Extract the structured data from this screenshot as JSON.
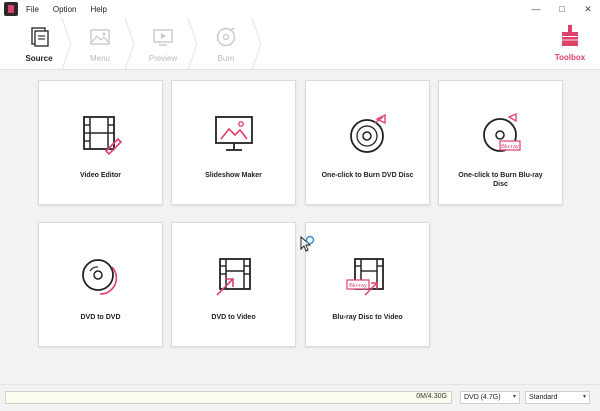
{
  "menu": [
    "File",
    "Option",
    "Help"
  ],
  "window_controls": [
    "—",
    "□",
    "✕"
  ],
  "steps": [
    {
      "label": "Source",
      "state": "active",
      "icon": "source-icon"
    },
    {
      "label": "Menu",
      "state": "disabled",
      "icon": "menu-image-icon"
    },
    {
      "label": "Preview",
      "state": "disabled",
      "icon": "preview-icon"
    },
    {
      "label": "Burn",
      "state": "disabled",
      "icon": "burn-disc-icon"
    }
  ],
  "toolbox": {
    "label": "Toolbox",
    "icon": "toolbox-icon"
  },
  "cards": [
    {
      "label": "Video Editor",
      "icon": "film-edit-icon"
    },
    {
      "label": "Slideshow Maker",
      "icon": "slideshow-monitor-icon"
    },
    {
      "label": "One-click to Burn DVD Disc",
      "icon": "dvd-burn-icon"
    },
    {
      "label": "One-click to Burn Blu-ray Disc",
      "icon": "bluray-burn-icon"
    },
    {
      "label": "DVD to DVD",
      "icon": "dvd-copy-icon"
    },
    {
      "label": "DVD to Video",
      "icon": "dvd-to-video-icon"
    },
    {
      "label": "Blu-ray Disc to Video",
      "icon": "bluray-to-video-icon"
    }
  ],
  "bluray_badge": "Blu-ray",
  "bottom": {
    "capacity_text": "0M/4.30G",
    "capacity_fraction": 0,
    "disc_type": "DVD (4.7G)",
    "quality": "Standard"
  },
  "colors": {
    "accent": "#e0416a",
    "disabled": "#b9b9b9"
  }
}
